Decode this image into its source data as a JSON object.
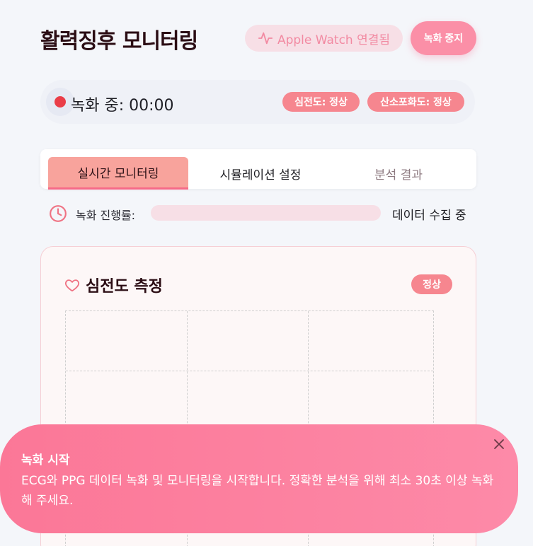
{
  "header": {
    "title": "활력징후 모니터링",
    "watch_status": "Apple Watch 연결됨",
    "stop_label": "녹화 중지"
  },
  "recording": {
    "status": "녹화 중: 00:00",
    "badges": [
      "심전도: 정상",
      "산소포화도: 정상"
    ]
  },
  "tabs": [
    {
      "label": "실시간 모니터링",
      "active": true
    },
    {
      "label": "시뮬레이션 설정",
      "active": false
    },
    {
      "label": "분석 결과",
      "active": false
    }
  ],
  "progress": {
    "label": "녹화 진행률:",
    "value_percent": 0,
    "status": "데이터 수집 중"
  },
  "ecg_card": {
    "title": "심전도 측정",
    "badge": "정상"
  },
  "toast": {
    "title": "녹화 시작",
    "message": "ECG와 PPG 데이터 녹화 및 모니터링을 시작합니다. 정확한 분석을 위해 최소 30초 이상 녹화해 주세요."
  },
  "colors": {
    "accent": "#fb8fa7",
    "badge": "#f6868f",
    "recording_dot": "#ea3d48"
  }
}
